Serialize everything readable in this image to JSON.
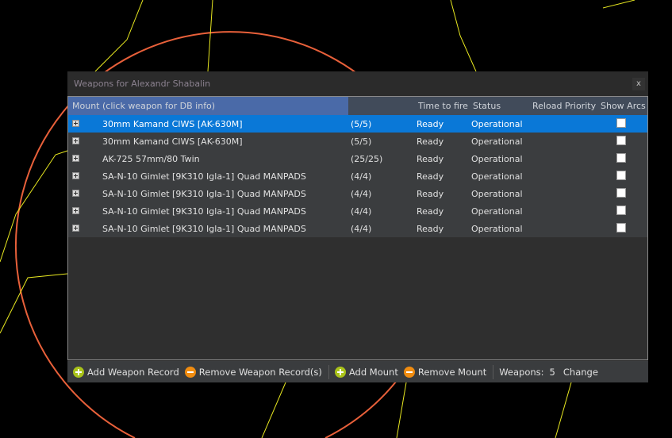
{
  "window": {
    "title": "Weapons for Alexandr Shabalin",
    "close_label": "x"
  },
  "columns": {
    "mount": "Mount (click weapon for DB info)",
    "ammo": "",
    "time_to_fire": "Time to fire",
    "status": "Status",
    "reload_priority": "Reload Priority",
    "show_arcs": "Show Arcs"
  },
  "rows": [
    {
      "mount": "30mm Kamand CIWS [AK-630M]",
      "ammo": "(5/5)",
      "time_to_fire": "Ready",
      "status": "Operational",
      "selected": true,
      "show_arcs": false
    },
    {
      "mount": "30mm Kamand CIWS [AK-630M]",
      "ammo": "(5/5)",
      "time_to_fire": "Ready",
      "status": "Operational",
      "selected": false,
      "show_arcs": false
    },
    {
      "mount": "AK-725 57mm/80 Twin",
      "ammo": "(25/25)",
      "time_to_fire": "Ready",
      "status": "Operational",
      "selected": false,
      "show_arcs": false
    },
    {
      "mount": "SA-N-10 Gimlet [9K310 Igla-1] Quad MANPADS",
      "ammo": "(4/4)",
      "time_to_fire": "Ready",
      "status": "Operational",
      "selected": false,
      "show_arcs": false
    },
    {
      "mount": "SA-N-10 Gimlet [9K310 Igla-1] Quad MANPADS",
      "ammo": "(4/4)",
      "time_to_fire": "Ready",
      "status": "Operational",
      "selected": false,
      "show_arcs": false
    },
    {
      "mount": "SA-N-10 Gimlet [9K310 Igla-1] Quad MANPADS",
      "ammo": "(4/4)",
      "time_to_fire": "Ready",
      "status": "Operational",
      "selected": false,
      "show_arcs": false
    },
    {
      "mount": "SA-N-10 Gimlet [9K310 Igla-1] Quad MANPADS",
      "ammo": "(4/4)",
      "time_to_fire": "Ready",
      "status": "Operational",
      "selected": false,
      "show_arcs": false
    }
  ],
  "toolbar": {
    "add_weapon_record": "Add Weapon Record",
    "remove_weapon_records": "Remove Weapon Record(s)",
    "add_mount": "Add Mount",
    "remove_mount": "Remove Mount",
    "weapons_label": "Weapons:",
    "weapons_count": "5",
    "change": "Change"
  },
  "colors": {
    "selection": "#0a78d7",
    "add_icon": "#a9c21a",
    "remove_icon": "#f08c10",
    "map_lines": "#e8e820",
    "range_ring": "#e8603a"
  }
}
